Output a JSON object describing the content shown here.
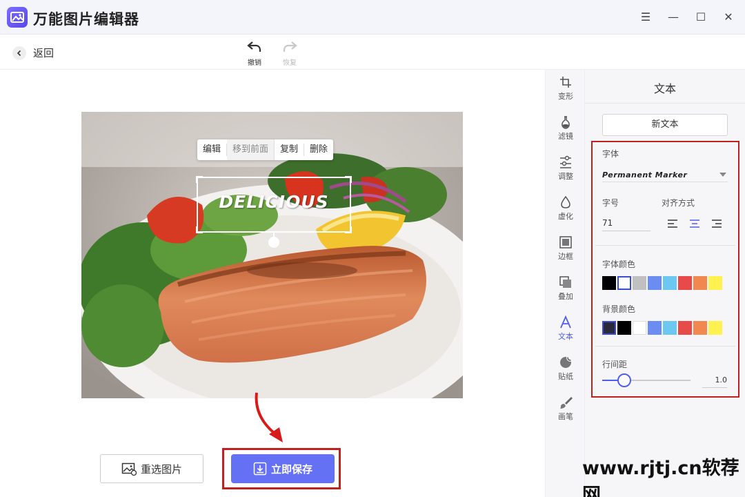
{
  "app": {
    "title": "万能图片编辑器"
  },
  "window_controls": {
    "menu": "☰",
    "minimize": "—",
    "maximize": "☐",
    "close": "✕"
  },
  "toolbar": {
    "back_label": "返回",
    "undo_label": "撤销",
    "redo_label": "恢复"
  },
  "context_menu": {
    "items": [
      "编辑",
      "移到前面",
      "复制",
      "删除"
    ]
  },
  "text_layer": {
    "text": "DELICIOUS"
  },
  "actions": {
    "reselect_label": "重选图片",
    "save_label": "立即保存"
  },
  "toolstrip": {
    "items": [
      {
        "label": "变形",
        "icon": "crop-icon"
      },
      {
        "label": "滤镜",
        "icon": "flask-icon"
      },
      {
        "label": "调整",
        "icon": "sliders-icon"
      },
      {
        "label": "虚化",
        "icon": "drop-icon"
      },
      {
        "label": "边框",
        "icon": "frame-icon"
      },
      {
        "label": "叠加",
        "icon": "layers-icon"
      },
      {
        "label": "文本",
        "icon": "text-icon",
        "active": true
      },
      {
        "label": "贴纸",
        "icon": "sticker-icon"
      },
      {
        "label": "画笔",
        "icon": "brush-icon"
      }
    ]
  },
  "panel": {
    "title": "文本",
    "new_text_label": "新文本",
    "font_label": "字体",
    "font_value": "Permanent Marker",
    "size_label": "字号",
    "size_value": "71",
    "align_label": "对齐方式",
    "align_selected": "center",
    "font_color_label": "字体颜色",
    "font_colors": [
      "#000000",
      "#ffffff",
      "#c0c0c0",
      "#6b8cf0",
      "#6cc8f0",
      "#e84a4a",
      "#f08850",
      "#fff250"
    ],
    "font_color_selected_index": 1,
    "bg_color_label": "背景颜色",
    "bg_colors": [
      "#2a2a3a",
      "#000000",
      "#ffffff",
      "#6b8cf0",
      "#6cc8f0",
      "#e84a4a",
      "#f08850",
      "#fff250"
    ],
    "bg_color_selected_index": 0,
    "line_spacing_label": "行间距",
    "line_spacing_value": "1.0",
    "line_spacing_fraction": 0.25
  },
  "watermark": "www.rjtj.cn软荐网",
  "colors": {
    "accent": "#6571f4",
    "highlight": "#c0211f"
  }
}
